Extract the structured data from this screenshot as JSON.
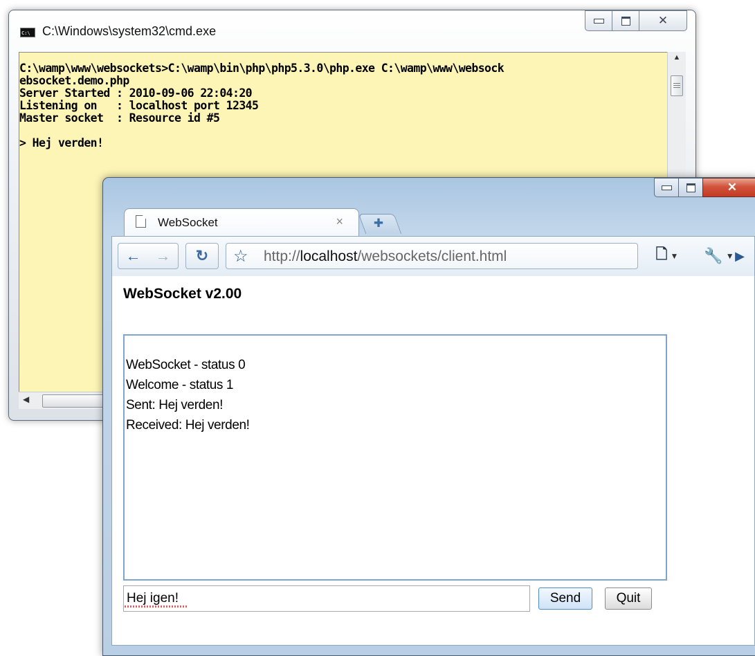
{
  "cmd": {
    "title": "C:\\Windows\\system32\\cmd.exe",
    "logo_text": "C:\\",
    "output_lines": [
      "C:\\wamp\\www\\websockets>C:\\wamp\\bin\\php\\php5.3.0\\php.exe C:\\wamp\\www\\websock",
      "ebsocket.demo.php",
      "Server Started : 2010-09-06 22:04:20",
      "Listening on   : localhost port 12345",
      "Master socket  : Resource id #5",
      "",
      "> Hej verden!"
    ],
    "background_color": "#fdf5b6"
  },
  "browser": {
    "tab_title": "WebSocket",
    "url_prefix": "http://",
    "url_host": "localhost",
    "url_path": "/websockets/client.html",
    "page_heading": "WebSocket v2.00",
    "log_lines": [
      "WebSocket - status 0",
      "Welcome - status 1",
      "Sent: Hej verden!",
      "Received: Hej verden!"
    ],
    "message_input_value": "Hej igen!",
    "send_label": "Send",
    "quit_label": "Quit",
    "close_color": "#c23a23"
  },
  "icons": {
    "minimize": "minimize-icon",
    "maximize": "maximize-icon",
    "close": "close-icon",
    "back": "back-arrow-icon",
    "forward": "forward-arrow-icon",
    "reload": "reload-icon",
    "star": "star-icon",
    "go": "go-arrow-icon",
    "page": "page-menu-icon",
    "wrench": "wrench-menu-icon",
    "new_tab": "new-tab-icon",
    "tab_close": "tab-close-icon"
  }
}
